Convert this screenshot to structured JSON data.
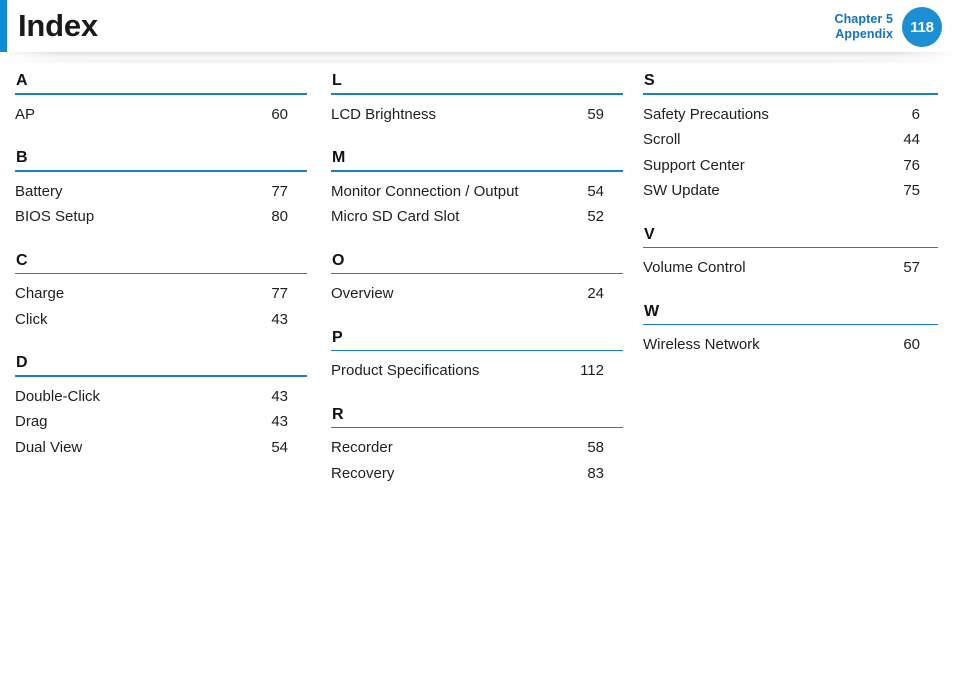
{
  "header": {
    "title": "Index",
    "chapter_line1": "Chapter 5",
    "chapter_line2": "Appendix",
    "page_number": "118",
    "accent_color": "#0d8bd4",
    "badge_color": "#1b8fd1",
    "chapter_text_color": "#1274bd",
    "rule_color": "#1c7fc4"
  },
  "columns": [
    {
      "groups": [
        {
          "letter": "A",
          "entries": [
            {
              "label": "AP",
              "page": "60"
            }
          ]
        },
        {
          "letter": "B",
          "entries": [
            {
              "label": "Battery",
              "page": "77"
            },
            {
              "label": "BIOS Setup",
              "page": "80"
            }
          ]
        },
        {
          "letter": "C",
          "entries": [
            {
              "label": "Charge",
              "page": "77"
            },
            {
              "label": "Click",
              "page": "43"
            }
          ]
        },
        {
          "letter": "D",
          "entries": [
            {
              "label": "Double-Click",
              "page": "43"
            },
            {
              "label": "Drag",
              "page": "43"
            },
            {
              "label": "Dual View",
              "page": "54"
            }
          ]
        }
      ]
    },
    {
      "groups": [
        {
          "letter": "L",
          "entries": [
            {
              "label": "LCD Brightness",
              "page": "59"
            }
          ]
        },
        {
          "letter": "M",
          "entries": [
            {
              "label": "Monitor Connection / Output",
              "page": "54"
            },
            {
              "label": "Micro SD Card Slot",
              "page": "52"
            }
          ]
        },
        {
          "letter": "O",
          "entries": [
            {
              "label": "Overview",
              "page": "24"
            }
          ]
        },
        {
          "letter": "P",
          "entries": [
            {
              "label": "Product Specifications",
              "page": "112"
            }
          ]
        },
        {
          "letter": "R",
          "entries": [
            {
              "label": "Recorder",
              "page": "58"
            },
            {
              "label": "Recovery",
              "page": "83"
            }
          ]
        }
      ]
    },
    {
      "groups": [
        {
          "letter": "S",
          "entries": [
            {
              "label": "Safety Precautions",
              "page": "6"
            },
            {
              "label": "Scroll",
              "page": "44"
            },
            {
              "label": "Support Center",
              "page": "76"
            },
            {
              "label": "SW Update",
              "page": "75"
            }
          ]
        },
        {
          "letter": "V",
          "entries": [
            {
              "label": "Volume Control",
              "page": "57"
            }
          ]
        },
        {
          "letter": "W",
          "entries": [
            {
              "label": "Wireless Network",
              "page": "60"
            }
          ]
        }
      ]
    }
  ]
}
